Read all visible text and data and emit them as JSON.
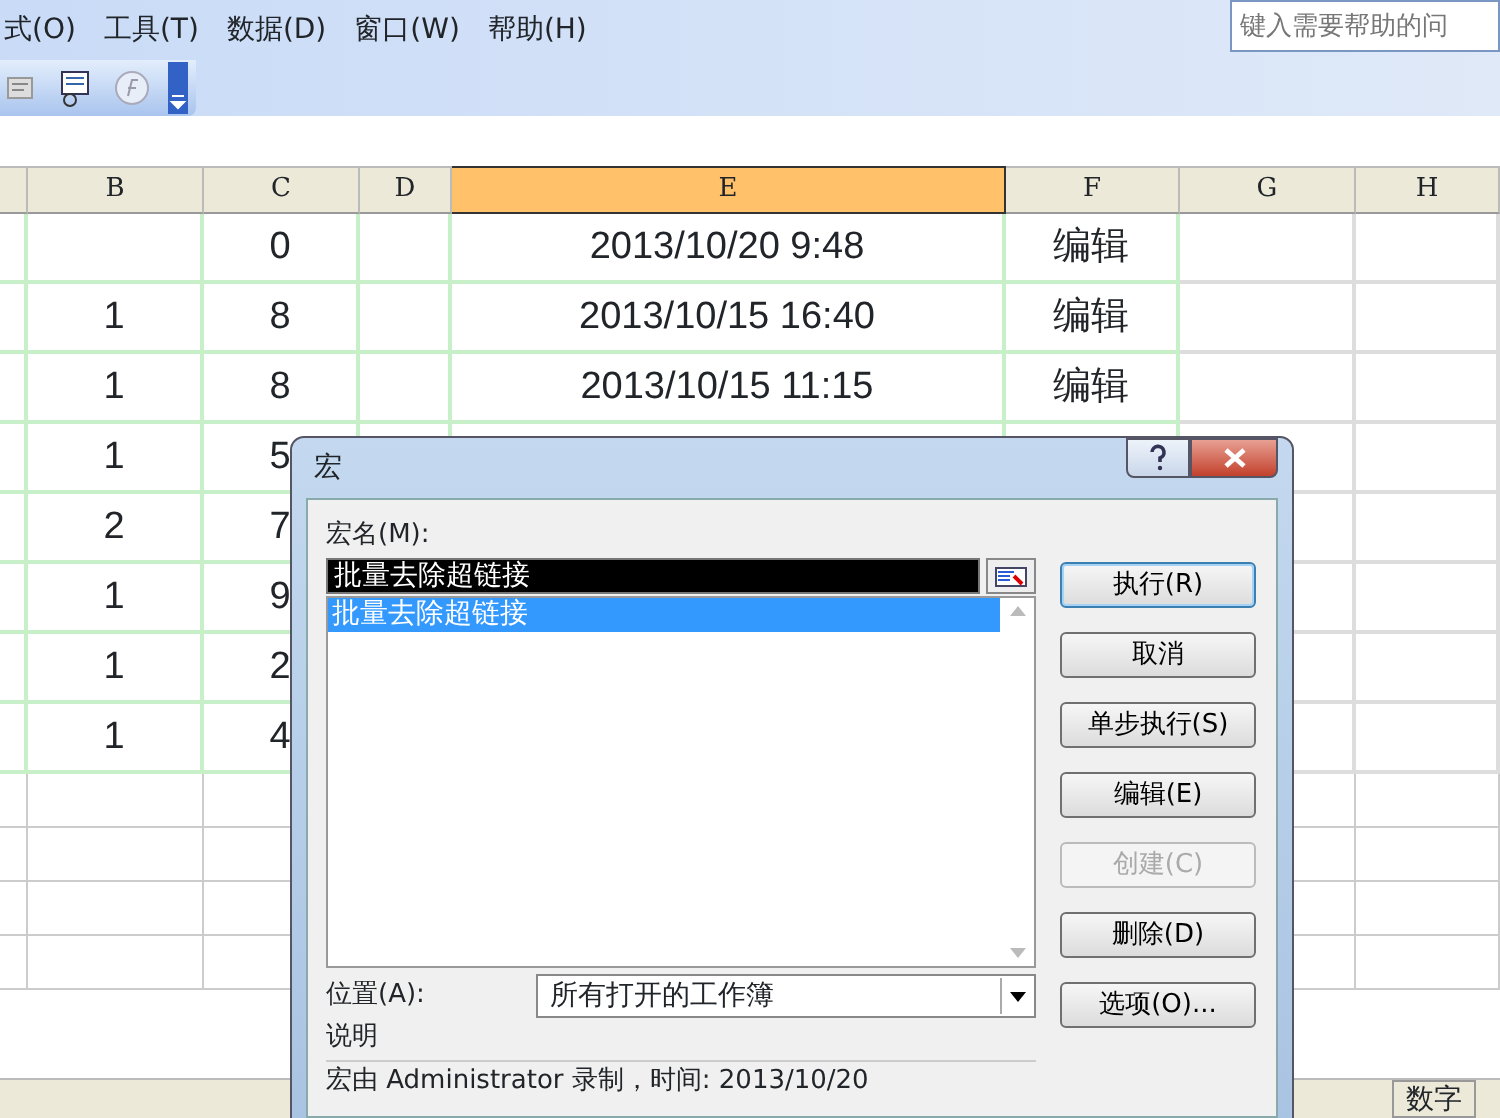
{
  "menu_bar": {
    "items": [
      "式(O)",
      "工具(T)",
      "数据(D)",
      "窗口(W)",
      "帮助(H)"
    ],
    "help_search": {
      "placeholder": "键入需要帮助的问"
    }
  },
  "sheet": {
    "columns": [
      {
        "label": "B",
        "selected": false
      },
      {
        "label": "C",
        "selected": false
      },
      {
        "label": "D",
        "selected": false
      },
      {
        "label": "E",
        "selected": true
      },
      {
        "label": "F",
        "selected": false
      },
      {
        "label": "G",
        "selected": false
      },
      {
        "label": "H",
        "selected": false
      }
    ],
    "rows": [
      [
        "",
        "0",
        "",
        "2013/10/20 9:48",
        "编辑"
      ],
      [
        "1",
        "8",
        "",
        "2013/10/15 16:40",
        "编辑"
      ],
      [
        "1",
        "8",
        "",
        "2013/10/15 11:15",
        "编辑"
      ],
      [
        "1",
        "5"
      ],
      [
        "2",
        "7"
      ],
      [
        "1",
        "9"
      ],
      [
        "1",
        "2"
      ],
      [
        "1",
        "4"
      ]
    ]
  },
  "dialog": {
    "title": "宏",
    "macro_name_label": "宏名(M):",
    "macro_name_value": "批量去除超链接",
    "macros": [
      {
        "label": "批量去除超链接",
        "selected": true
      }
    ],
    "buttons": [
      {
        "label": "执行(R)",
        "disabled": false
      },
      {
        "label": "取消",
        "disabled": false
      },
      {
        "label": "单步执行(S)",
        "disabled": false
      },
      {
        "label": "编辑(E)",
        "disabled": false
      },
      {
        "label": "创建(C)",
        "disabled": true
      },
      {
        "label": "删除(D)",
        "disabled": false
      },
      {
        "label": "选项(O)...",
        "disabled": false
      }
    ],
    "location_label": "位置(A):",
    "location_value": "所有打开的工作簿",
    "description_label": "说明",
    "description": "宏由 Administrator 录制，时间: 2013/10/20"
  },
  "status_bar": {
    "mode": "数字"
  }
}
